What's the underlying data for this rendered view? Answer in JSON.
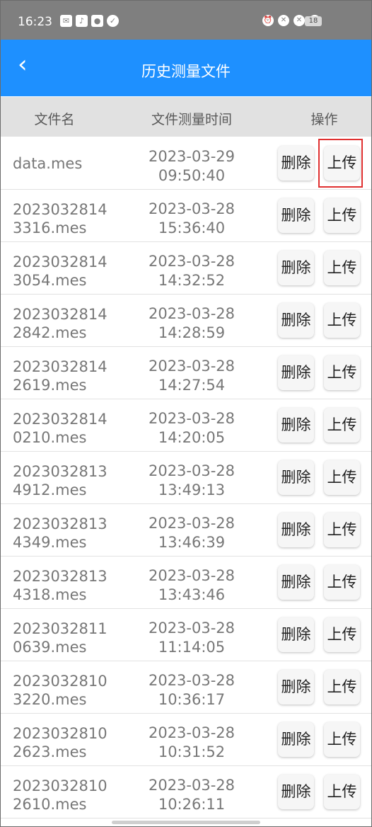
{
  "status": {
    "time": "16:23",
    "left_icons": [
      "mail-icon",
      "tiktok-icon",
      "map-pin-icon",
      "check-icon"
    ],
    "right_icons": [
      "alarm-icon",
      "mute-icon",
      "no-sim-icon",
      "wifi-icon"
    ],
    "battery": "18"
  },
  "app": {
    "title": "历史测量文件"
  },
  "table": {
    "headers": {
      "name": "文件名",
      "time": "文件测量时间",
      "op": "操作"
    },
    "delete_label": "删除",
    "upload_label": "上传",
    "rows": [
      {
        "name": "data.mes",
        "time1": "2023-03-29",
        "time2": "09:50:40"
      },
      {
        "name1": "2023032814",
        "name2": "3316.mes",
        "time1": "2023-03-28",
        "time2": "15:36:40"
      },
      {
        "name1": "2023032814",
        "name2": "3054.mes",
        "time1": "2023-03-28",
        "time2": "14:32:52"
      },
      {
        "name1": "2023032814",
        "name2": "2842.mes",
        "time1": "2023-03-28",
        "time2": "14:28:59"
      },
      {
        "name1": "2023032814",
        "name2": "2619.mes",
        "time1": "2023-03-28",
        "time2": "14:27:54"
      },
      {
        "name1": "2023032814",
        "name2": "0210.mes",
        "time1": "2023-03-28",
        "time2": "14:20:05"
      },
      {
        "name1": "2023032813",
        "name2": "4912.mes",
        "time1": "2023-03-28",
        "time2": "13:49:13"
      },
      {
        "name1": "2023032813",
        "name2": "4349.mes",
        "time1": "2023-03-28",
        "time2": "13:46:39"
      },
      {
        "name1": "2023032813",
        "name2": "4318.mes",
        "time1": "2023-03-28",
        "time2": "13:43:46"
      },
      {
        "name1": "2023032811",
        "name2": "0639.mes",
        "time1": "2023-03-28",
        "time2": "11:14:05"
      },
      {
        "name1": "2023032810",
        "name2": "3220.mes",
        "time1": "2023-03-28",
        "time2": "10:36:17"
      },
      {
        "name1": "2023032810",
        "name2": "2623.mes",
        "time1": "2023-03-28",
        "time2": "10:31:52"
      },
      {
        "name1": "2023032810",
        "name2": "2610.mes",
        "time1": "2023-03-28",
        "time2": "10:26:11"
      }
    ]
  },
  "colors": {
    "appbar": "#1e90ff",
    "statusbar": "#7f7f7f",
    "highlight": "#e03030"
  }
}
